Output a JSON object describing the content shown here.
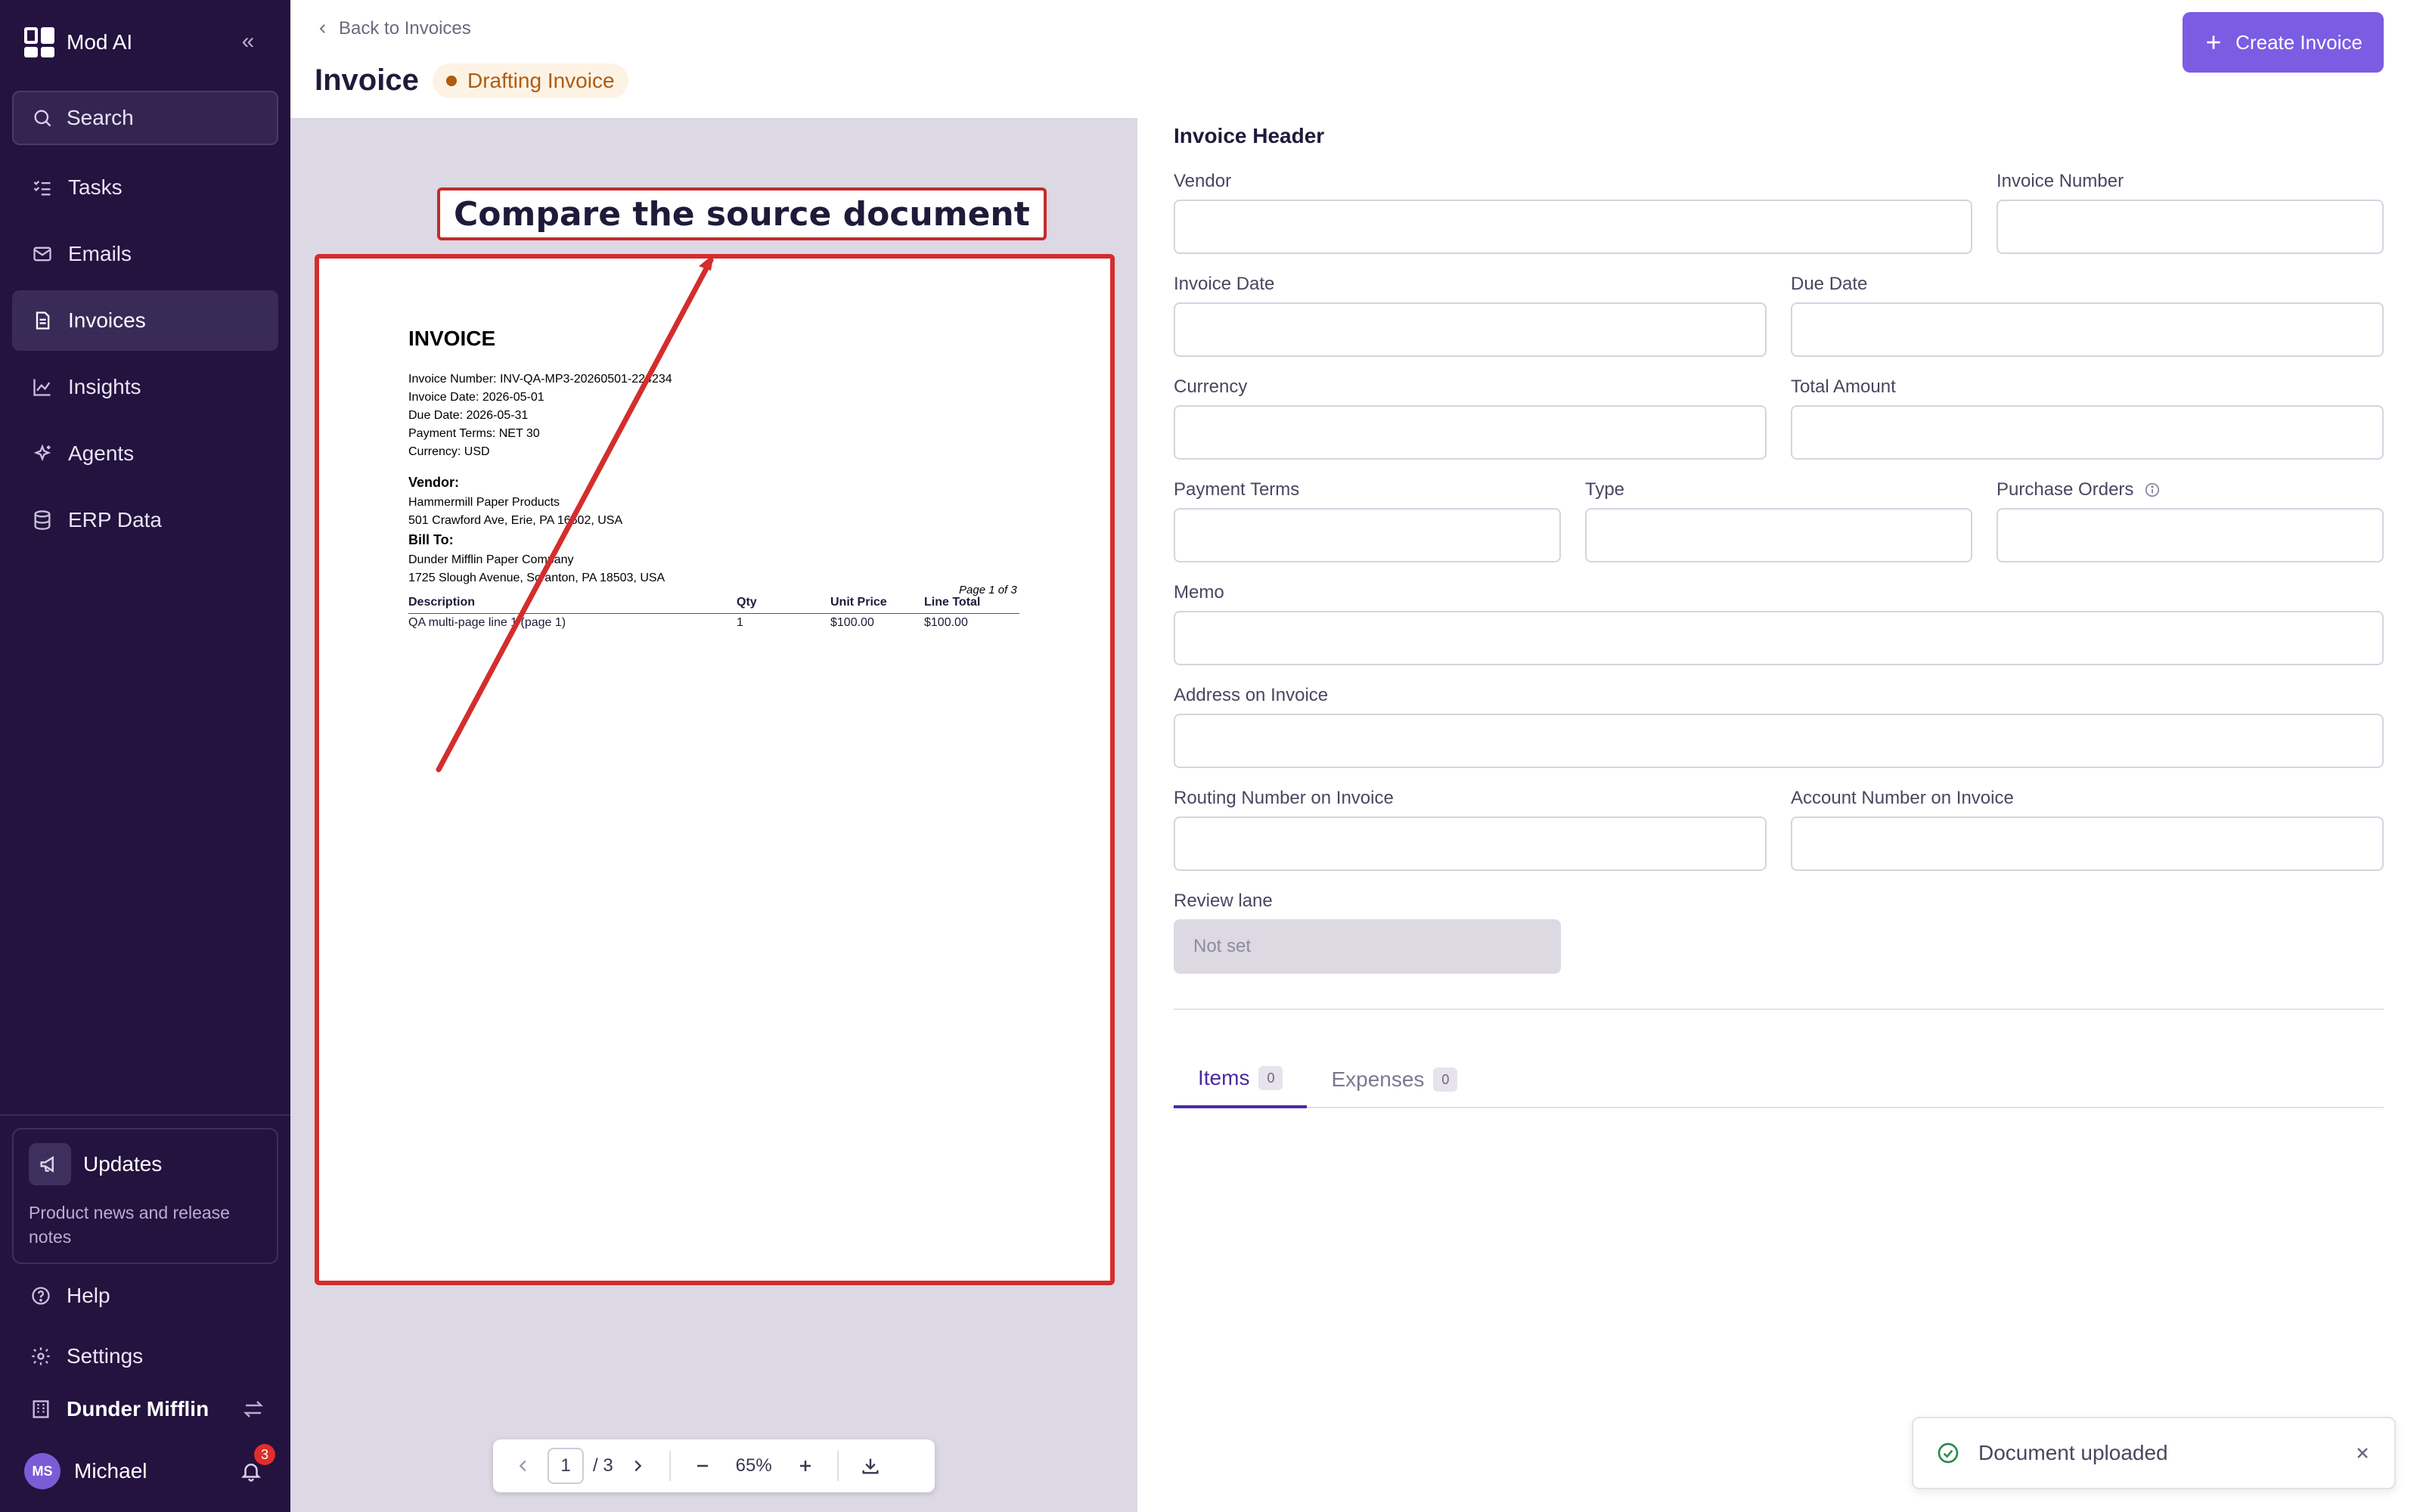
{
  "app": {
    "name": "Mod AI",
    "search_label": "Search"
  },
  "sidebar": {
    "items": [
      {
        "label": "Tasks",
        "icon": "tasks-icon"
      },
      {
        "label": "Emails",
        "icon": "mail-icon"
      },
      {
        "label": "Invoices",
        "icon": "invoice-icon",
        "active": true
      },
      {
        "label": "Insights",
        "icon": "chart-icon"
      },
      {
        "label": "Agents",
        "icon": "sparkle-icon"
      },
      {
        "label": "ERP Data",
        "icon": "database-icon"
      }
    ],
    "updates": {
      "title": "Updates",
      "description": "Product news and release notes"
    },
    "help_label": "Help",
    "settings_label": "Settings",
    "org_name": "Dunder Mifflin",
    "user": {
      "initials": "MS",
      "name": "Michael",
      "notification_count": "3"
    }
  },
  "header": {
    "back_label": "Back to Invoices",
    "title": "Invoice",
    "status": "Drafting Invoice",
    "create_label": "Create Invoice"
  },
  "viewer": {
    "annotation": "Compare the source document",
    "document": {
      "title": "INVOICE",
      "meta_lines": [
        "Invoice Number: INV-QA-MP3-20260501-224234",
        "Invoice Date: 2026-05-01",
        "Due Date: 2026-05-31",
        "Payment Terms: NET 30",
        "Currency: USD"
      ],
      "vendor_heading": "Vendor:",
      "vendor_lines": [
        "Hammermill Paper Products",
        "501 Crawford Ave, Erie, PA 16502, USA"
      ],
      "billto_heading": "Bill To:",
      "billto_lines": [
        "Dunder Mifflin Paper Company",
        "1725 Slough Avenue, Scranton, PA 18503, USA"
      ],
      "page_note": "Page 1 of 3",
      "table_headers": [
        "Description",
        "Qty",
        "Unit Price",
        "Line Total"
      ],
      "table_rows": [
        [
          "QA multi-page line 1 (page 1)",
          "1",
          "$100.00",
          "$100.00"
        ]
      ]
    },
    "pager": {
      "current_page": "1",
      "total_pages": "/ 3",
      "zoom": "65%"
    }
  },
  "form": {
    "section_title": "Invoice Header",
    "fields": {
      "vendor": {
        "label": "Vendor",
        "value": ""
      },
      "invoice_number": {
        "label": "Invoice Number",
        "value": ""
      },
      "invoice_date": {
        "label": "Invoice Date",
        "value": ""
      },
      "due_date": {
        "label": "Due Date",
        "value": ""
      },
      "currency": {
        "label": "Currency",
        "value": ""
      },
      "total_amount": {
        "label": "Total Amount",
        "value": ""
      },
      "payment_terms": {
        "label": "Payment Terms",
        "value": ""
      },
      "type": {
        "label": "Type",
        "value": ""
      },
      "purchase_orders": {
        "label": "Purchase Orders",
        "value": ""
      },
      "memo": {
        "label": "Memo",
        "value": ""
      },
      "address": {
        "label": "Address on Invoice",
        "value": ""
      },
      "routing_number": {
        "label": "Routing Number on Invoice",
        "value": ""
      },
      "account_number": {
        "label": "Account Number on Invoice",
        "value": ""
      },
      "review_lane": {
        "label": "Review lane",
        "value": "Not set"
      }
    },
    "tabs": [
      {
        "label": "Items",
        "count": "0",
        "active": true
      },
      {
        "label": "Expenses",
        "count": "0"
      }
    ]
  },
  "toast": {
    "message": "Document uploaded"
  },
  "colors": {
    "sidebar_bg": "#24123f",
    "accent": "#7b5ce3",
    "status_warning": "#b05b0e",
    "annotation_red": "#d42d2d"
  }
}
